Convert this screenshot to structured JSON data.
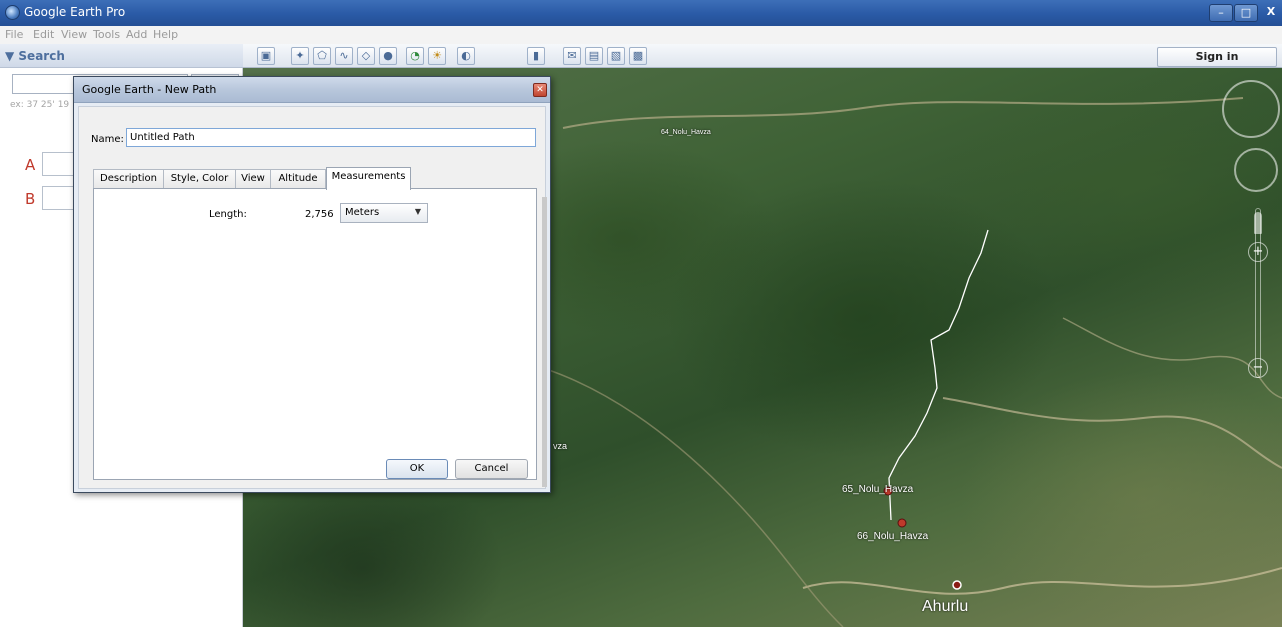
{
  "window": {
    "title": "Google Earth Pro",
    "controls": {
      "minimize": "–",
      "maximize": "□",
      "close": "X"
    }
  },
  "menu": [
    "File",
    "Edit",
    "View",
    "Tools",
    "Add",
    "Help"
  ],
  "search_panel": {
    "header": "▼ Search",
    "input_value": "",
    "hint": "ex: 37 25' 19",
    "directions": {
      "a_label": "A",
      "b_label": "B"
    }
  },
  "toolbar": {
    "icons": [
      "sidebar-toggle-icon",
      "placemark-icon",
      "polygon-icon",
      "path-icon",
      "image-overlay-icon",
      "tour-icon",
      "historical-imagery-icon",
      "sunlight-icon",
      "planets-icon",
      "ruler-icon",
      "email-icon",
      "print-icon",
      "save-image-icon",
      "maps-icon"
    ],
    "sign_in_label": "Sign in"
  },
  "map": {
    "labels": {
      "label_64": "64_Nolu_Havza",
      "label_65": "65_Nolu_Havza",
      "label_66": "66_Nolu_Havza",
      "label_partial": "vza",
      "village": "Ahurlu"
    },
    "marker_color": "#c0392b",
    "path_color": "#ffffff"
  },
  "dialog": {
    "title": "Google Earth - New Path",
    "name_label": "Name:",
    "name_value": "Untitled Path",
    "tabs": [
      "Description",
      "Style, Color",
      "View",
      "Altitude",
      "Measurements"
    ],
    "active_tab": "Measurements",
    "measurements": {
      "length_label": "Length:",
      "length_value": "2,756",
      "unit": "Meters"
    },
    "ok_label": "OK",
    "cancel_label": "Cancel"
  }
}
